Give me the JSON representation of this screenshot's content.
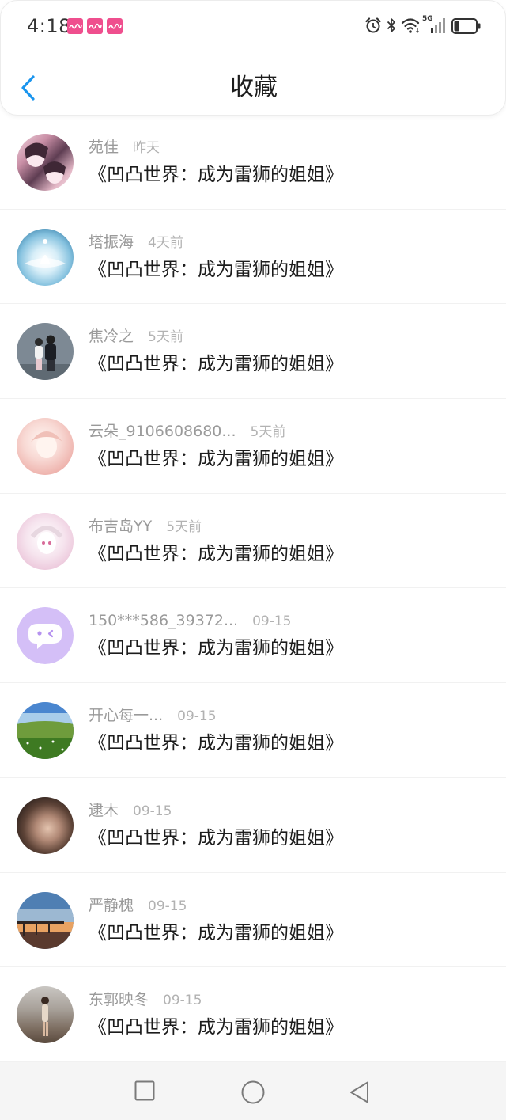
{
  "status_bar": {
    "time": "4:18",
    "network_label": "5G",
    "battery_level": 0.25,
    "icons": {
      "notifications": [
        "app-notification-icon",
        "app-notification-icon",
        "app-notification-icon"
      ],
      "alarm": "alarm-icon",
      "bluetooth": "bluetooth-icon",
      "wifi": "wifi-icon",
      "signal": "signal-icon",
      "battery": "battery-icon"
    }
  },
  "header": {
    "title": "收藏",
    "back_icon": "chevron-left-icon"
  },
  "items": [
    {
      "name": "苑佳",
      "time": "昨天",
      "title": "《凹凸世界：成为雷狮的姐姐》"
    },
    {
      "name": "塔振海",
      "time": "4天前",
      "title": "《凹凸世界：成为雷狮的姐姐》"
    },
    {
      "name": "焦冷之",
      "time": "5天前",
      "title": "《凹凸世界：成为雷狮的姐姐》"
    },
    {
      "name": "云朵_9106608680...",
      "time": "5天前",
      "title": "《凹凸世界：成为雷狮的姐姐》"
    },
    {
      "name": "布吉岛YY",
      "time": "5天前",
      "title": "《凹凸世界：成为雷狮的姐姐》"
    },
    {
      "name": "150***586_39372...",
      "time": "09-15",
      "title": "《凹凸世界：成为雷狮的姐姐》"
    },
    {
      "name": "开心每一...",
      "time": "09-15",
      "title": "《凹凸世界：成为雷狮的姐姐》"
    },
    {
      "name": "逮木",
      "time": "09-15",
      "title": "《凹凸世界：成为雷狮的姐姐》"
    },
    {
      "name": "严静槐",
      "time": "09-15",
      "title": "《凹凸世界：成为雷狮的姐姐》"
    },
    {
      "name": "东郭映冬",
      "time": "09-15",
      "title": "《凹凸世界：成为雷狮的姐姐》"
    }
  ],
  "nav_bar": {
    "icons": [
      "square-recents-icon",
      "circle-home-icon",
      "triangle-back-icon"
    ]
  },
  "colors": {
    "accent": "#1a95ee",
    "title_text": "#1c1c1c",
    "meta_text": "#9a9a9a",
    "notification_pink": "#ef4f8e",
    "chat_avatar": "#d4bff7"
  }
}
